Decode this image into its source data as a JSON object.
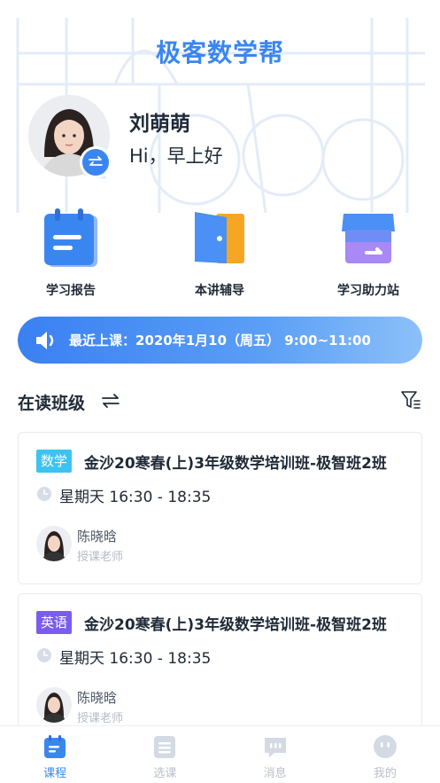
{
  "header": {
    "app_title": "极客数学帮",
    "user_name": "刘萌萌",
    "greeting": "Hi，早上好"
  },
  "quick_actions": [
    {
      "label": "学习报告",
      "icon": "report-icon"
    },
    {
      "label": "本讲辅导",
      "icon": "door-book-icon"
    },
    {
      "label": "学习助力站",
      "icon": "store-icon"
    }
  ],
  "notice": {
    "text": "最近上课：2020年1月10（周五） 9:00~11:00",
    "icon": "speaker-icon"
  },
  "section": {
    "title": "在读班级"
  },
  "classes": [
    {
      "tag": "数学",
      "tag_color": "#3cc3f1",
      "title": "金沙20寒春(上)3年级数学培训班-极智班2班",
      "time": "星期天   16:30 - 18:35",
      "teacher_name": "陈晓晗",
      "teacher_role": "授课老师"
    },
    {
      "tag": "英语",
      "tag_color": "#7a5cf0",
      "title": "金沙20寒春(上)3年级数学培训班-极智班2班",
      "time": "星期天   16:30 - 18:35",
      "teacher_name": "陈晓晗",
      "teacher_role": "授课老师"
    }
  ],
  "tabbar": [
    {
      "label": "课程",
      "active": true
    },
    {
      "label": "选课",
      "active": false
    },
    {
      "label": "消息",
      "active": false
    },
    {
      "label": "我的",
      "active": false
    }
  ],
  "colors": {
    "accent": "#3a86f0",
    "text": "#1f2a37",
    "muted": "#b8c0cb"
  }
}
